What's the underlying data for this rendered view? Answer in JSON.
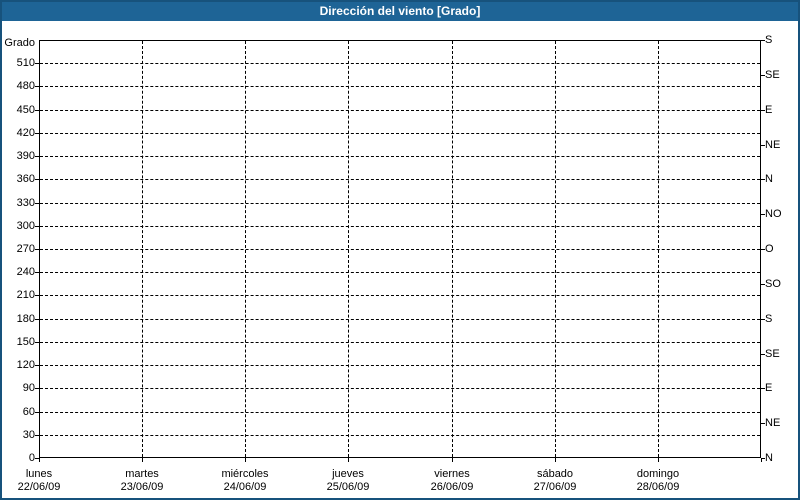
{
  "header": {
    "title": "Dirección del viento [Grado]"
  },
  "colors": {
    "titlebar_background": "#1e6496",
    "titlebar_text": "#ffffff",
    "window_border": "#17527c",
    "grid_line": "#000000",
    "plot_background": "#ffffff",
    "label_text": "#000000"
  },
  "chart_data": {
    "type": "line",
    "title": "Dirección del viento [Grado]",
    "series": [],
    "grid": {
      "style": "dashed",
      "horizontal_step_deg": 30,
      "vertical": "one line per day"
    },
    "y_left": {
      "label": "Grado",
      "min": 0,
      "max": 540,
      "tick_step": 30,
      "ticks": [
        0,
        30,
        60,
        90,
        120,
        150,
        180,
        210,
        240,
        270,
        300,
        330,
        360,
        390,
        420,
        450,
        480,
        510
      ]
    },
    "y_right": {
      "tick_step": 45,
      "ticks": [
        {
          "value": 0,
          "label": "N"
        },
        {
          "value": 45,
          "label": "NE"
        },
        {
          "value": 90,
          "label": "E"
        },
        {
          "value": 135,
          "label": "SE"
        },
        {
          "value": 180,
          "label": "S"
        },
        {
          "value": 225,
          "label": "SO"
        },
        {
          "value": 270,
          "label": "O"
        },
        {
          "value": 315,
          "label": "NO"
        },
        {
          "value": 360,
          "label": "N"
        },
        {
          "value": 405,
          "label": "NE"
        },
        {
          "value": 450,
          "label": "E"
        },
        {
          "value": 495,
          "label": "SE"
        },
        {
          "value": 540,
          "label": "S"
        }
      ]
    },
    "x": {
      "days": [
        {
          "name": "lunes",
          "date": "22/06/09"
        },
        {
          "name": "martes",
          "date": "23/06/09"
        },
        {
          "name": "miércoles",
          "date": "24/06/09"
        },
        {
          "name": "jueves",
          "date": "25/06/09"
        },
        {
          "name": "viernes",
          "date": "26/06/09"
        },
        {
          "name": "sábado",
          "date": "27/06/09"
        },
        {
          "name": "domingo",
          "date": "28/06/09"
        }
      ]
    }
  }
}
